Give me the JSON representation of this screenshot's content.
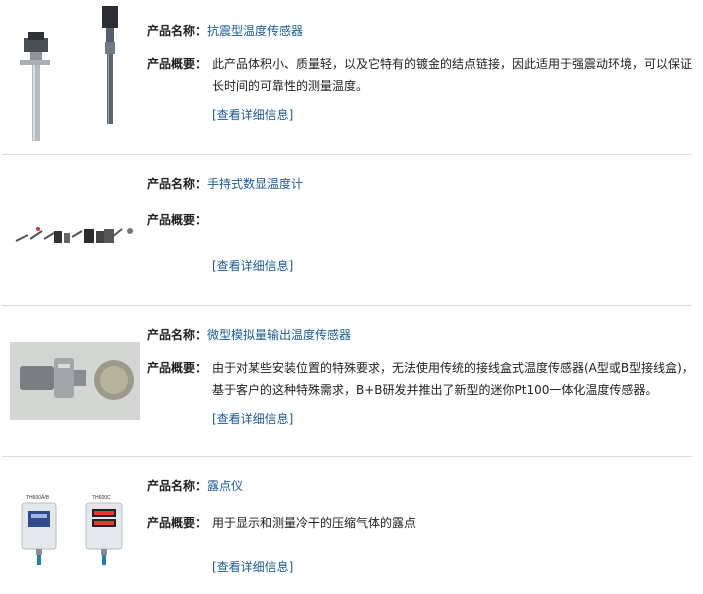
{
  "labels": {
    "name": "产品名称：",
    "summary": "产品概要：",
    "more": "[查看详细信息]"
  },
  "products": [
    {
      "name": "抗震型温度传感器",
      "summary": "此产品体积小、质量轻，以及它特有的镀金的结点链接，因此适用于强震动环境，可以保证长时间的可靠性的测量温度。",
      "image_icon": "temperature-probe-icon"
    },
    {
      "name": "手持式数显温度计",
      "summary": "",
      "image_icon": "thermometer-probes-icon"
    },
    {
      "name": "微型模拟量输出温度传感器",
      "summary": "由于对某些安装位置的特殊要求，无法使用传统的接线盒式温度传感器(A型或B型接线盒)，基于客户的这种特殊需求，B+B研发并推出了新型的迷你Pt100一体化温度传感器。",
      "image_icon": "mini-sensor-icon"
    },
    {
      "name": "露点仪",
      "summary": "用于显示和测量冷干的压缩气体的露点",
      "image_icon": "dewpoint-meter-icon",
      "image_labels": [
        "TH600A/B",
        "TH600C"
      ]
    }
  ]
}
